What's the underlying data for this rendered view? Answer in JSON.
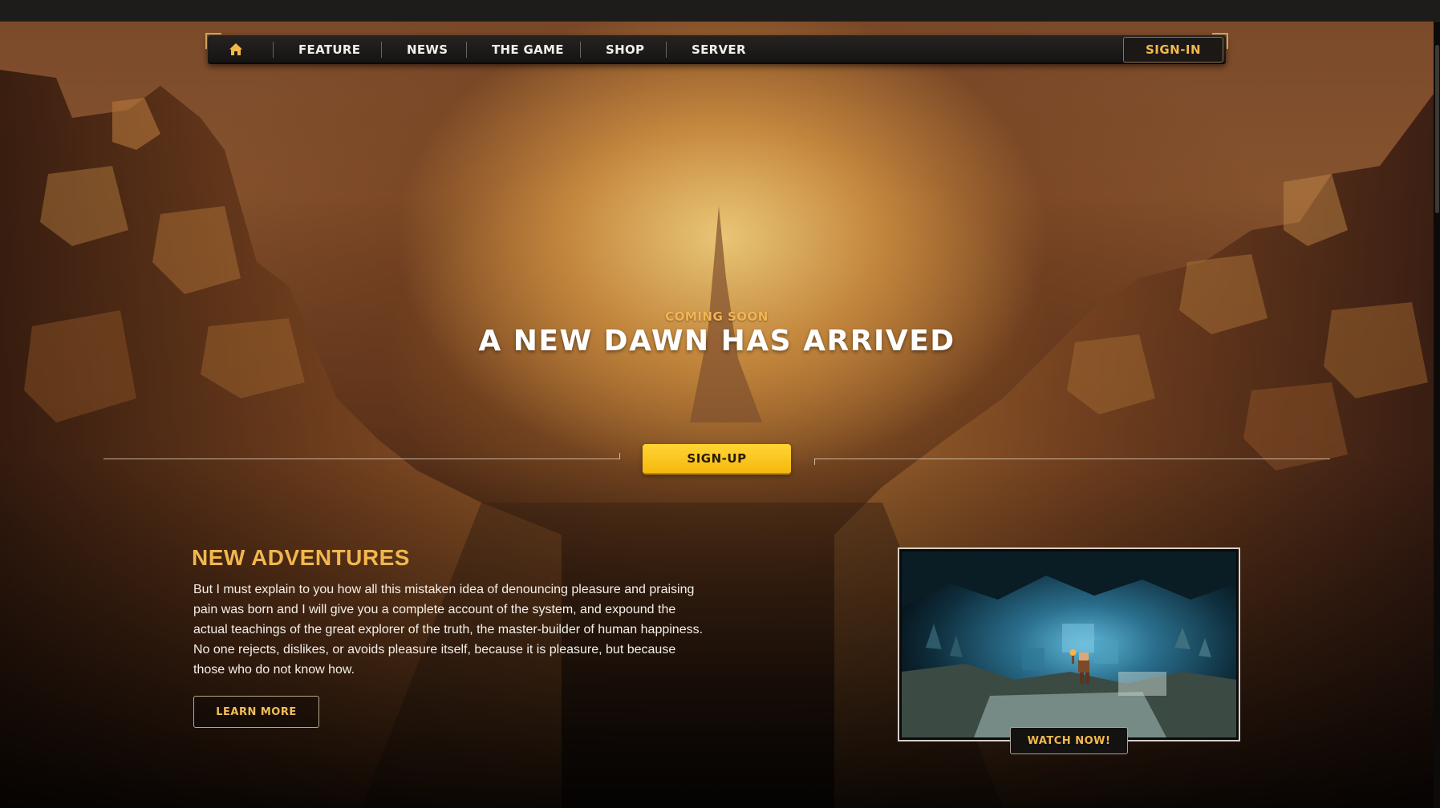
{
  "nav": {
    "home_icon": "home-icon",
    "items": [
      {
        "label": "FEATURE"
      },
      {
        "label": "NEWS"
      },
      {
        "label": "THE GAME"
      },
      {
        "label": "SHOP"
      },
      {
        "label": "SERVER"
      }
    ],
    "signin_label": "SIGN-IN"
  },
  "hero": {
    "eyebrow": "COMING SOON",
    "headline": "A NEW DAWN HAS ARRIVED",
    "signup_label": "SIGN-UP"
  },
  "adventures": {
    "title": "NEW ADVENTURES",
    "body": "But I must explain to you how all this mistaken idea of denouncing pleasure and praising pain was born and I will give you a complete account of the system, and expound the actual teachings of the great explorer of the truth, the master-builder of human happiness. No one rejects, dislikes, or avoids pleasure itself, because it is pleasure, but because those who do not know how.",
    "learn_more_label": "LEARN MORE"
  },
  "video": {
    "watch_label": "WATCH NOW!"
  },
  "colors": {
    "accent_gold": "#f1b74e",
    "button_yellow": "#ffd535",
    "nav_bg": "#1d1b19",
    "text_light": "#f4f0ea"
  }
}
